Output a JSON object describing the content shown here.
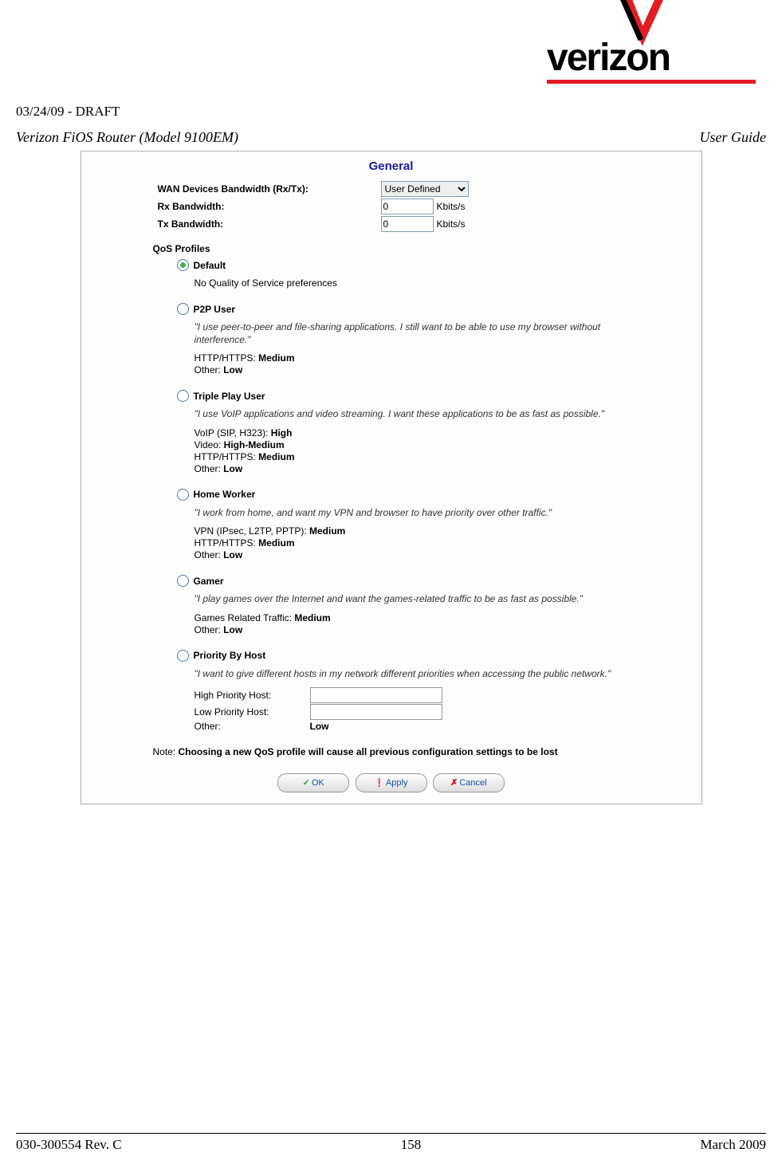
{
  "header": {
    "draft_line": "03/24/09 - DRAFT",
    "product_title": "Verizon FiOS Router (Model 9100EM)",
    "doc_type": "User Guide",
    "logo_text": "verizon"
  },
  "panel": {
    "title": "General",
    "wan": {
      "label": "WAN Devices Bandwidth (Rx/Tx):",
      "value": "User Defined"
    },
    "rx": {
      "label": "Rx Bandwidth:",
      "value": "0",
      "units": "Kbits/s"
    },
    "tx": {
      "label": "Tx Bandwidth:",
      "value": "0",
      "units": "Kbits/s"
    },
    "qos_header": "QoS Profiles",
    "profiles": {
      "default": {
        "name": "Default",
        "desc": "No Quality of Service preferences"
      },
      "p2p": {
        "name": "P2P User",
        "desc": "\"I use peer-to-peer and file-sharing applications. I still want to be able to use my browser without interference.\"",
        "p1_label": "HTTP/HTTPS: ",
        "p1_val": "Medium",
        "p2_label": "Other: ",
        "p2_val": "Low"
      },
      "triple": {
        "name": "Triple Play User",
        "desc": "\"I use VoIP applications and video streaming. I want these applications to be as fast as possible.\"",
        "p1_label": "VoIP (SIP, H323): ",
        "p1_val": "High",
        "p2_label": "Video: ",
        "p2_val": "High-Medium",
        "p3_label": "HTTP/HTTPS: ",
        "p3_val": "Medium",
        "p4_label": "Other: ",
        "p4_val": "Low"
      },
      "home": {
        "name": "Home Worker",
        "desc": "\"I work from home, and want my VPN and browser to have priority over other traffic.\"",
        "p1_label": "VPN (IPsec, L2TP, PPTP): ",
        "p1_val": "Medium",
        "p2_label": "HTTP/HTTPS: ",
        "p2_val": "Medium",
        "p3_label": "Other: ",
        "p3_val": "Low"
      },
      "gamer": {
        "name": "Gamer",
        "desc": "\"I play games over the Internet and want the games-related traffic to be as fast as possible.\"",
        "p1_label": "Games Related Traffic: ",
        "p1_val": "Medium",
        "p2_label": "Other: ",
        "p2_val": "Low"
      },
      "priority": {
        "name": "Priority By Host",
        "desc": "\"I want to give different hosts in my network different priorities when accessing the public network.\"",
        "high_label": "High Priority Host:",
        "low_label": "Low Priority Host:",
        "other_label": "Other:",
        "other_val": "Low"
      }
    },
    "note_label": "Note: ",
    "note_text": "Choosing a new QoS profile will cause all previous configuration settings to be lost",
    "buttons": {
      "ok": "OK",
      "apply": "Apply",
      "cancel": "Cancel"
    }
  },
  "footer": {
    "left": "030-300554 Rev. C",
    "center": "158",
    "right": "March 2009"
  }
}
